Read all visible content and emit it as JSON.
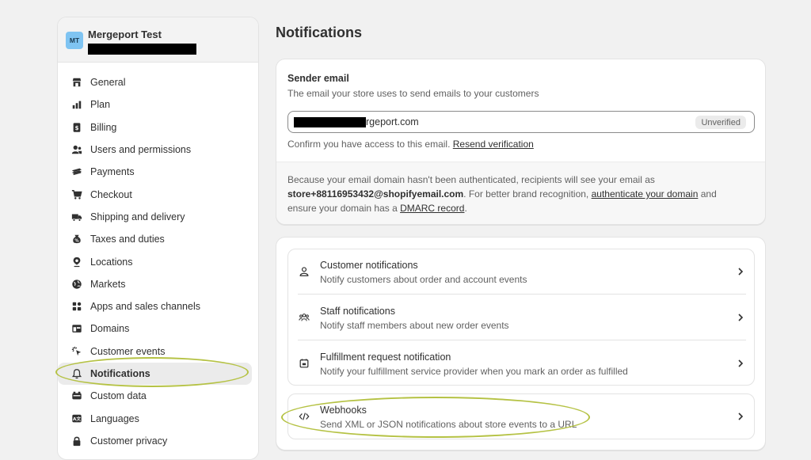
{
  "store": {
    "avatar_initials": "MT",
    "name": "Mergeport Test"
  },
  "sidebar": {
    "items": [
      {
        "label": "General",
        "icon": "store-icon"
      },
      {
        "label": "Plan",
        "icon": "plan-icon"
      },
      {
        "label": "Billing",
        "icon": "billing-icon"
      },
      {
        "label": "Users and permissions",
        "icon": "users-icon"
      },
      {
        "label": "Payments",
        "icon": "payments-icon"
      },
      {
        "label": "Checkout",
        "icon": "cart-icon"
      },
      {
        "label": "Shipping and delivery",
        "icon": "truck-icon"
      },
      {
        "label": "Taxes and duties",
        "icon": "tax-icon"
      },
      {
        "label": "Locations",
        "icon": "location-icon"
      },
      {
        "label": "Markets",
        "icon": "globe-icon"
      },
      {
        "label": "Apps and sales channels",
        "icon": "apps-icon"
      },
      {
        "label": "Domains",
        "icon": "domain-icon"
      },
      {
        "label": "Customer events",
        "icon": "cursor-icon"
      },
      {
        "label": "Notifications",
        "icon": "bell-icon",
        "active": true
      },
      {
        "label": "Custom data",
        "icon": "custom-data-icon"
      },
      {
        "label": "Languages",
        "icon": "language-icon"
      },
      {
        "label": "Customer privacy",
        "icon": "lock-icon"
      }
    ]
  },
  "page": {
    "title": "Notifications"
  },
  "sender": {
    "label": "Sender email",
    "description": "The email your store uses to send emails to your customers",
    "email_visible": "rgeport.com",
    "badge": "Unverified",
    "confirm_text": "Confirm you have access to this email.",
    "resend_link": "Resend verification",
    "info_1": "Because your email domain hasn't been authenticated, recipients will see your email as",
    "info_email": "store+88116953432@shopifyemail.com",
    "info_2": ". For better brand recognition,",
    "info_link_auth": "authenticate your domain",
    "info_3": "and",
    "info_4": "ensure your domain has a",
    "info_link_dmarc": "DMARC record",
    "info_5": "."
  },
  "notifications": {
    "rows": [
      {
        "title": "Customer notifications",
        "desc": "Notify customers about order and account events",
        "icon": "person-icon"
      },
      {
        "title": "Staff notifications",
        "desc": "Notify staff members about new order events",
        "icon": "team-icon"
      },
      {
        "title": "Fulfillment request notification",
        "desc": "Notify your fulfillment service provider when you mark an order as fulfilled",
        "icon": "calendar-icon"
      }
    ],
    "webhooks": {
      "title": "Webhooks",
      "desc": "Send XML or JSON notifications about store events to a URL",
      "icon": "code-icon"
    }
  },
  "colors": {
    "highlight_ring": "#b5c244",
    "avatar_bg": "#7fc4f2"
  }
}
